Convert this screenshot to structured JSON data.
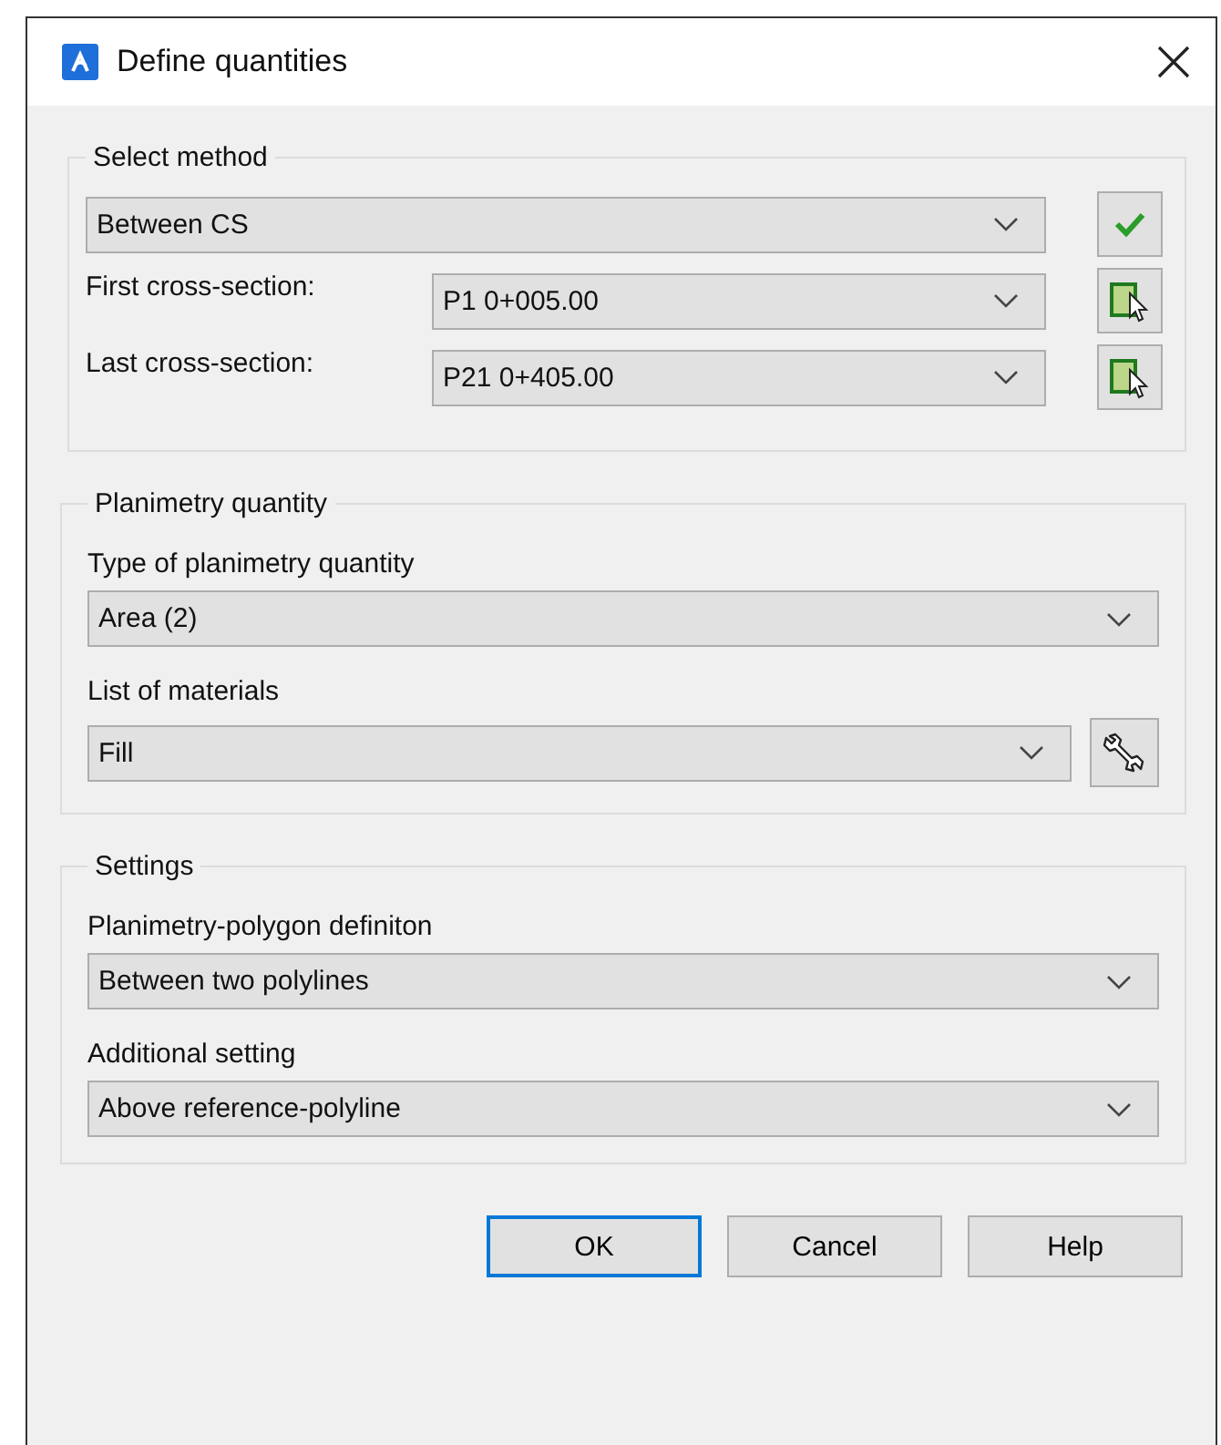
{
  "window": {
    "title": "Define quantities"
  },
  "select_method": {
    "title": "Select method",
    "method": "Between CS",
    "rows": [
      {
        "label": "First cross-section:",
        "value": "P1 0+005.00"
      },
      {
        "label": "Last cross-section:",
        "value": "P21 0+405.00"
      }
    ]
  },
  "groups": [
    {
      "title": "Planimetry quantity",
      "fields": [
        {
          "kind": "dropdown",
          "label": "Type of planimetry quantity",
          "value": "Area (2)"
        },
        {
          "kind": "dropdown_tool",
          "label": "List of materials",
          "value": "Fill"
        }
      ]
    },
    {
      "title": "Settings",
      "fields": [
        {
          "kind": "dropdown",
          "label": "Planimetry-polygon definiton",
          "value": "Between two polylines"
        },
        {
          "kind": "dropdown",
          "label": "Additional setting",
          "value": "Above reference-polyline"
        }
      ]
    }
  ],
  "buttons": [
    {
      "label": "OK",
      "default": true
    },
    {
      "label": "Cancel",
      "default": false
    },
    {
      "label": "Help",
      "default": false
    }
  ]
}
